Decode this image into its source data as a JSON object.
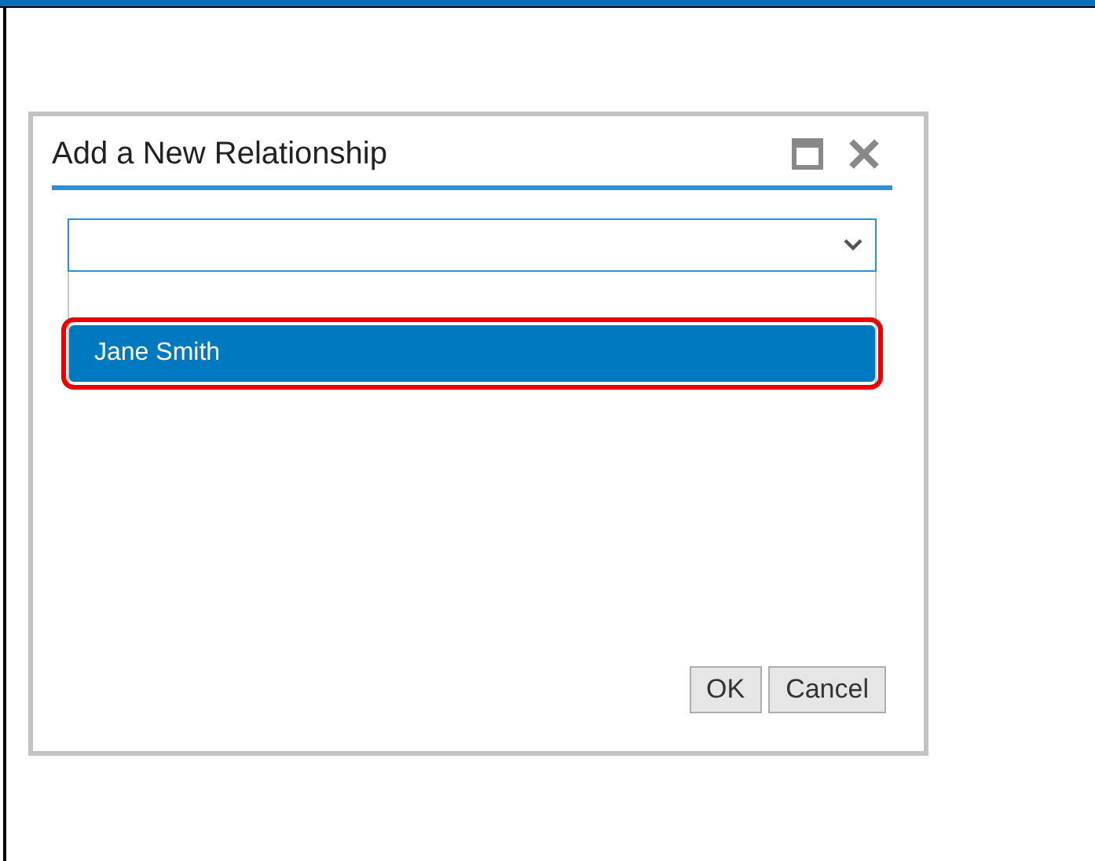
{
  "dialog": {
    "title": "Add a New Relationship",
    "select": {
      "options": [
        {
          "label": "Jane Smith",
          "selected": true,
          "highlighted": true
        }
      ]
    },
    "buttons": [
      {
        "label": "OK"
      },
      {
        "label": "Cancel"
      }
    ]
  }
}
